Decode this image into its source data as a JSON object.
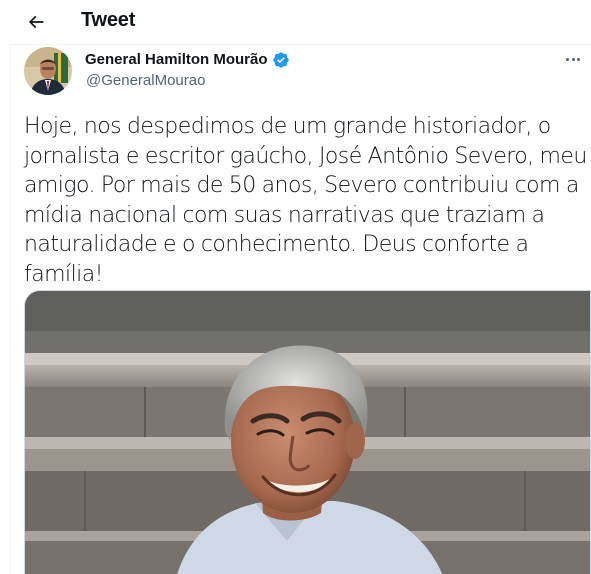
{
  "header": {
    "title": "Tweet",
    "back_icon": "arrow-left-icon"
  },
  "author": {
    "name": "General Hamilton Mourão",
    "handle": "@GeneralMourao",
    "verified": true,
    "verified_icon": "verified-badge-icon",
    "avatar_icon": "user-avatar"
  },
  "more_icon": "more-horizontal-icon",
  "tweet": {
    "lines": [
      "Hoje, nos despedimos de um grande historiador, o",
      "jornalista e escritor gaúcho, José Antônio Severo, meu",
      "amigo. Por mais de 50 anos, Severo contribuiu com a",
      "mídia nacional com suas narrativas que traziam a",
      "naturalidade e o conhecimento. Deus conforte a",
      "família!"
    ]
  },
  "colors": {
    "accent": "#1d9bf0",
    "text": "#0f1419",
    "secondary": "#536471"
  }
}
